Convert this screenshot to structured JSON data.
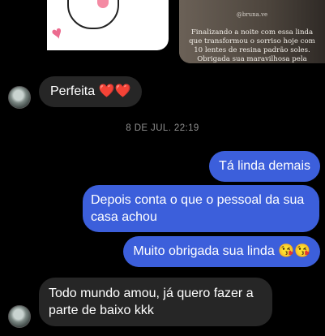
{
  "story": {
    "caption_top": "@bruna.ve",
    "caption_lines": "Finalizando a noite com essa linda\nque transformou o sorriso hoje com\n10 lentes de resina padrão soles.\nObrigada sua maravilhosa pela\nconfiança 😍🙏❤️\nEstá mais linda ainda agora a"
  },
  "messages": {
    "perfeita": "Perfeita ❤️❤️",
    "timestamp": "8 DE JUL. 22:19",
    "linda": "Tá linda demais",
    "depois": "Depois conta o que o pessoal da sua casa achou",
    "obrigada": "Muito obrigada sua linda 😘😘",
    "todo": "Todo mundo amou, já quero fazer a parte de baixo kkk"
  }
}
